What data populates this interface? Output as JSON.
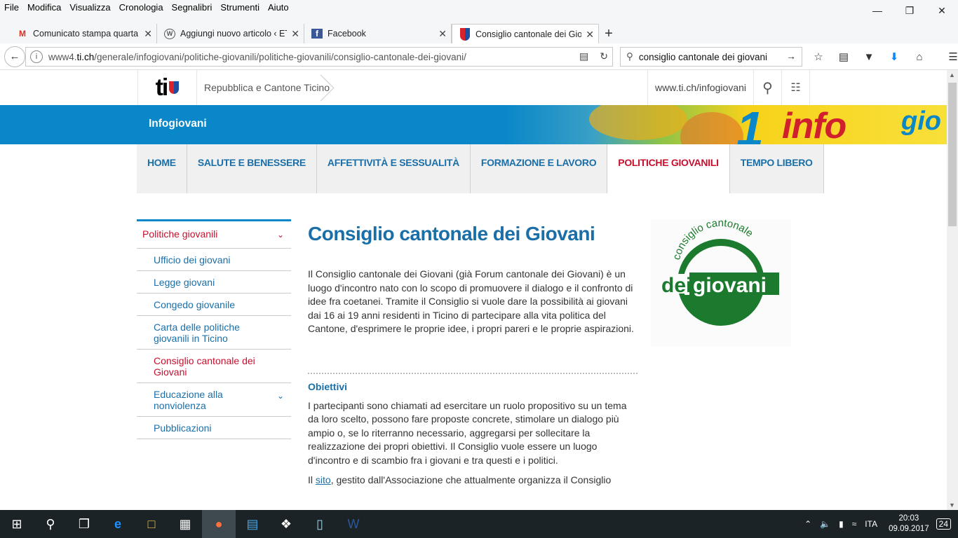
{
  "menu": [
    "File",
    "Modifica",
    "Visualizza",
    "Cronologia",
    "Segnalibri",
    "Strumenti",
    "Aiuto"
  ],
  "tabs": [
    {
      "label": "Comunicato stampa quarta",
      "icon": "gmail-icon",
      "fav": "M",
      "favColor": "#d93025"
    },
    {
      "label": "Aggiungi nuovo articolo ‹ ETiCin",
      "icon": "wordpress-icon",
      "fav": "",
      "favColor": "#555"
    },
    {
      "label": "Facebook",
      "icon": "facebook-icon",
      "fav": "f",
      "favColor": "#3b5998"
    },
    {
      "label": "Consiglio cantonale dei Giov",
      "icon": "ticino-shield-icon",
      "fav": "",
      "favColor": "#d8232a"
    }
  ],
  "url": {
    "prefix": "www4.",
    "domain": "ti.ch",
    "path": "/generale/infogiovani/politiche-giovanili/politiche-giovanili/consiglio-cantonale-dei-giovani/"
  },
  "search": {
    "value": "consiglio cantonale dei giovani"
  },
  "header": {
    "brand": "ti",
    "republic": "Repubblica e Cantone Ticino",
    "site": "www.ti.ch/infogiovani"
  },
  "banner": {
    "title": "Infogiovani",
    "art_text": "info",
    "art_text2": "gio"
  },
  "mainnav": [
    "HOME",
    "SALUTE E BENESSERE",
    "AFFETTIVITÀ E SESSUALITÀ",
    "FORMAZIONE E LAVORO",
    "POLITICHE GIOVANILI",
    "TEMPO LIBERO"
  ],
  "mainnav_active": 4,
  "sidebar": {
    "head": "Politiche giovanili",
    "items": [
      "Ufficio dei giovani",
      "Legge giovani",
      "Congedo giovanile",
      "Carta delle politiche giovanili in Ticino",
      "Consiglio cantonale dei Giovani",
      "Educazione alla nonviolenza",
      "Pubblicazioni"
    ],
    "active": 4
  },
  "content": {
    "title": "Consiglio cantonale dei Giovani",
    "intro": "Il Consiglio cantonale dei Giovani (già Forum cantonale dei Giovani) è un luogo d'incontro nato con lo scopo di promuovere il dialogo e il confronto di idee fra coetanei. Tramite il Consiglio si vuole dare la possibilità ai giovani dai 16 ai 19 anni residenti in Ticino di partecipare alla vita politica del Cantone, d'esprimere le proprie idee, i propri pareri e le proprie aspirazioni.",
    "section_title": "Obiettivi",
    "section_text": "I partecipanti sono chiamati ad esercitare un ruolo propositivo su un tema da loro scelto, possono fare proposte concrete, stimolare un dialogo più ampio o, se lo riterranno necessario, aggregarsi per sollecitare la realizzazione dei propri obiettivi. Il Consiglio vuole essere un luogo d'incontro e di scambio fra i giovani e tra questi e i politici.",
    "last_pre": "Il ",
    "last_link": "sito",
    "last_post": ", gestito dall'Associazione che attualmente organizza il Consiglio"
  },
  "cglogo": {
    "top": "consiglio cantonale",
    "bottom_left": "dei",
    "bottom_right": "giovani",
    "color": "#1b7a2e"
  },
  "tray": {
    "lang": "ITA",
    "time": "20:03",
    "date": "09.09.2017",
    "notif": "24"
  }
}
